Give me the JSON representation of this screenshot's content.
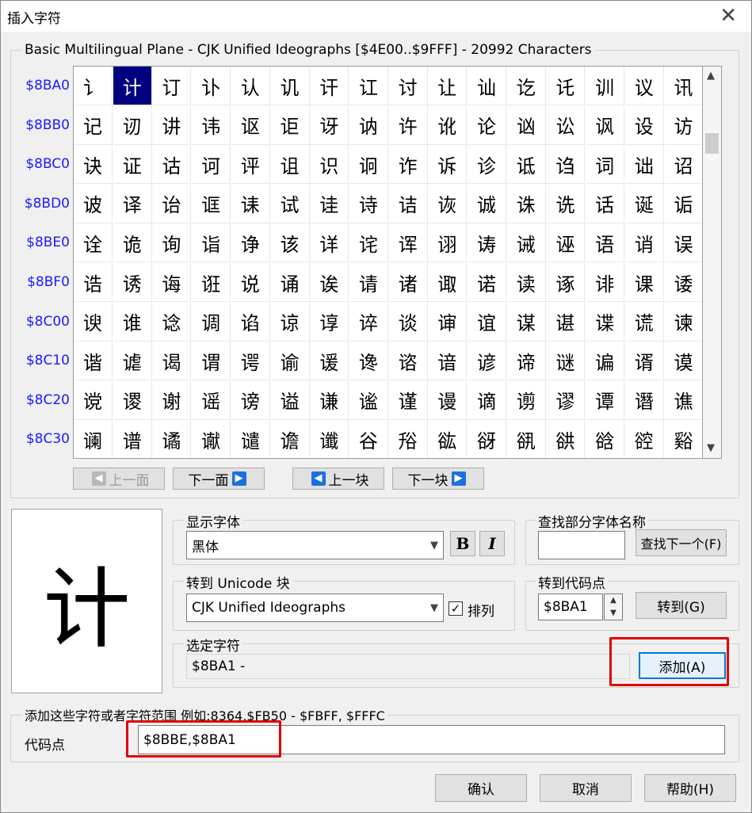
{
  "window": {
    "title": "插入字符",
    "close_glyph": "✕"
  },
  "plane_label": "Basic Multilingual Plane - CJK Unified Ideographs [$4E00..$9FFF] - 20992 Characters",
  "grid": {
    "row_labels": [
      "$8BA0",
      "$8BB0",
      "$8BC0",
      "$8BD0",
      "$8BE0",
      "$8BF0",
      "$8C00",
      "$8C10",
      "$8C20",
      "$8C30"
    ],
    "rows": [
      "讠计订讣认讥讦讧讨让讪讫讬训议讯",
      "记讱讲讳讴讵讶讷许讹论讻讼讽设访",
      "诀证诂诃评诅识诇诈诉诊诋诌词诎诏",
      "诐译诒诓诔试诖诗诘诙诚诛诜话诞诟",
      "诠诡询诣诤该详诧诨诩诪诫诬语诮误",
      "诰诱诲诳说诵诶请诸诹诺读诼诽课诿",
      "谀谁谂调谄谅谆谇谈谉谊谋谌谍谎谏",
      "谐谑谒谓谔谕谖谗谘谙谚谛谜谝谞谟",
      "谠谡谢谣谤谥谦谧谨谩谪谫谬谭谮谯",
      "谰谱谲谳谴谵谶谷谸谹谺谻谼谽谾谿"
    ]
  },
  "nav": {
    "prev_page": "上一面",
    "next_page": "下一面",
    "prev_block": "上一块",
    "next_block": "下一块"
  },
  "preview_char": "计",
  "display_font": {
    "legend": "显示字体",
    "value": "黑体",
    "bold": "B",
    "italic": "I"
  },
  "find_font": {
    "legend": "查找部分字体名称",
    "value": "",
    "button": "查找下一个(F)"
  },
  "goto_block": {
    "legend": "转到 Unicode 块",
    "value": "CJK Unified Ideographs",
    "sort_label": "排列",
    "sort_checked": true
  },
  "goto_code": {
    "legend": "转到代码点",
    "value": "$8BA1",
    "button": "转到(G)"
  },
  "selected": {
    "legend": "选定字符",
    "value": "$8BA1 -",
    "add_button": "添加(A)"
  },
  "add_group": {
    "legend": "添加这些字符或者字符范围 例如:8364,$FB50 - $FBFF, $FFFC",
    "field_label": "代码点",
    "value": "$8BBE,$8BA1"
  },
  "footer": {
    "ok": "确认",
    "cancel": "取消",
    "help": "帮助(H)"
  },
  "colors": {
    "selection": "#000080",
    "row_label": "#1a1aff",
    "highlight": "#e00000",
    "arrow": "#1e6fdc"
  }
}
